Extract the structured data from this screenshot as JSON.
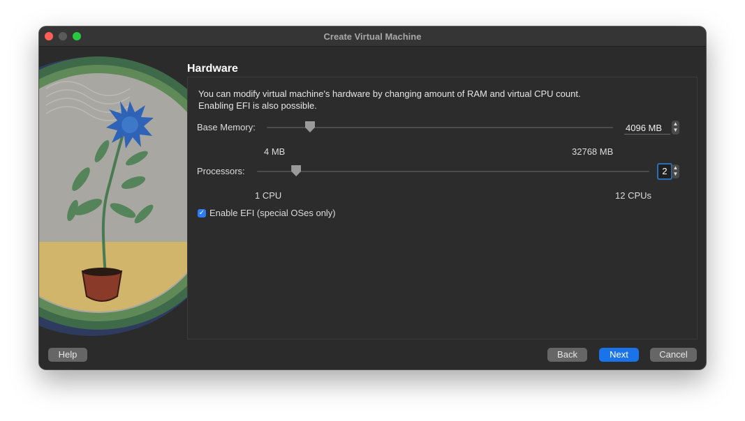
{
  "window": {
    "title": "Create Virtual Machine"
  },
  "page": {
    "heading": "Hardware",
    "description_line1": "You can modify virtual machine's hardware by changing amount of RAM and virtual CPU count.",
    "description_line2": "Enabling EFI is also possible."
  },
  "memory": {
    "label": "Base Memory:",
    "value": "4096 MB",
    "min_label": "4 MB",
    "max_label": "32768 MB",
    "level": 0.125
  },
  "processors": {
    "label": "Processors:",
    "value": "2",
    "min_label": "1 CPU",
    "max_label": "12 CPUs",
    "level": 0.1
  },
  "efi": {
    "label": "Enable EFI (special OSes only)",
    "checked": true
  },
  "buttons": {
    "help": "Help",
    "back": "Back",
    "next": "Next",
    "cancel": "Cancel"
  },
  "colors": {
    "accent": "#1a73e8",
    "checkbox": "#2c7cf6",
    "window_bg": "#2b2b2b"
  }
}
